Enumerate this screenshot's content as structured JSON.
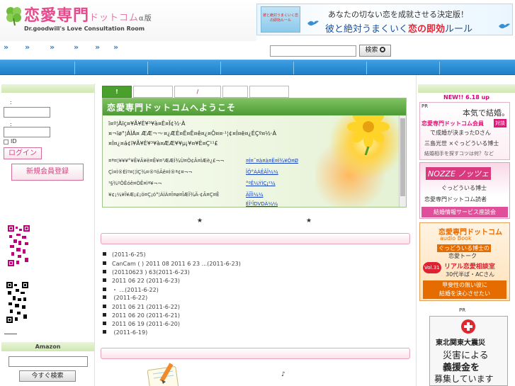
{
  "header": {
    "logo_title": "恋愛専門",
    "logo_suffix": "ドットコム",
    "logo_badge": "α版",
    "logo_subtitle": "Dr.goodwill's Love Consultation Room",
    "banner_book_text": "彼と絶対うまくいく恋の即効ルール",
    "banner_line1": "あなたの切ない恋を成就させる決定版！",
    "banner_line2_pre": "彼と絶対うまくいく",
    "banner_line2_red": "恋の即効",
    "banner_line2_post": "ルール"
  },
  "nav": {
    "arrows": [
      "»",
      "»",
      "»",
      "»",
      "»",
      "»"
    ],
    "search_value": "",
    "search_button": "検索"
  },
  "login": {
    "label1": ":",
    "label2": ":",
    "remember_label": "ID",
    "login_button": "ログイン",
    "register_button": "新規会員登録"
  },
  "amazon": {
    "heading": "Amazon",
    "search_button": "今すぐ検索"
  },
  "tabs": [
    {
      "label": "!"
    },
    {
      "label": ""
    },
    {
      "label": "/"
    },
    {
      "label": ""
    },
    {
      "label": ""
    }
  ],
  "welcome": {
    "title": "恋愛専門ドットコムへようこそ",
    "lines": [
      "ï¤º¦Àïç¤¥Ã¥È¥³¥à¤È¤Ï¢½·À",
      "¤¬ïø°¦ÀÌÀ¤ ÆÆ¬¬·¤¿ÆÈ¤Ë¤Ê¤ê¤¿¤Ô¤¤·¹¦¢¤Í¤ë¤¿ÉÇº¤½·À",
      "¤Ì¤¿¤á¢ï¥Ã¥È¥³¥à¤ÆÆ¥¥µ¡¥¤¥È¤Ç¹¹£"
    ],
    "news_left": [
      "¤ª¤¦¥¥¥°¥Ê¥Ä¥ë¤Ê¥¤³ÆÆÌ¾Ù¤Ò¢Â¤ÌÆè¿£¬¬",
      "Çì¤Ì®Èìº¤¦¦ÌÇ¾¤®ºöÃê¤Ì®ª¢¤¬¬",
      "¹§¾ºÔÊóê¤ÒÊ¤ìª¥¬¬",
      "¥¢¡¼¥Ï¥Æ¡£¡ö¤Ç¡ó°¦ÀÌÀ¤Ï¤ø¤ÎÆÏ¾Ä·¢Ã¤Ç¤Ê"
    ],
    "news_links": [
      "¤Ì¤¯¤à¤à¤Ë¤Ì¾¥Ò¤Ø",
      "ÎÔ°ÀÁÊÂÎ¼¼",
      "°ºÊ¼ÝÌÇ¡²¼",
      "ÄÎÎÌ¼¼"
    ],
    "news_link_extra": "ÉÎ¹ÎDVDÀ¼¼"
  },
  "stars": [
    "★",
    "★"
  ],
  "news": [
    {
      "text": "(2011-6-25)"
    },
    {
      "text": "CanCam (     ) 2011 08       2011 6 23  ...(2011-6-23)"
    },
    {
      "text": "(20110623 )              63(2011-6-23)"
    },
    {
      "text": "2011 06 22        (2011-6-23)"
    },
    {
      "text": "・                ...(2011-6-22)"
    },
    {
      "text": "          (2011-6-22)"
    },
    {
      "text": "2011 06 21          (2011-6-22)"
    },
    {
      "text": "2011 06 20          (2011-6-21)"
    },
    {
      "text": "2011 06 19          (2011-6-20)"
    },
    {
      "text": "                (2011-6-19)"
    }
  ],
  "music_note": "♪",
  "right": {
    "new_label": "NEW!! 6.18 up",
    "pr_label": "PR",
    "ad1": {
      "line1": "本気で結婚。",
      "line2": "恋愛専門ドットコム会員",
      "line3": "で成婚が決まったDさん",
      "line4": "三島光世 ×ぐっどういる博士",
      "line5": "結婚相手を探すコツは何？など",
      "badge": "対談"
    },
    "ad2": {
      "brand": "NOZZE ノッツェ",
      "line1": "ぐっどういる博士",
      "line2": "恋愛専門ドットコム読者",
      "line3": "結婚情報サービス座談会"
    },
    "ad3": {
      "line1": "恋愛専門ドットコム",
      "line2": "audio Book",
      "line3": "ぐっどういる博士の",
      "line4": "恋愛トーク",
      "badge": "Vol.31",
      "line5": "リアル恋愛相談室",
      "line6": "30代半ば・ACさん",
      "line7": "甲斐性の無い彼に",
      "line8": "結婚を決心させたい"
    },
    "pr_label2": "PR",
    "ad4": {
      "line1": "東北関東大震災",
      "line2": "災害による",
      "line3": "義援金を",
      "line4": "募集しています"
    }
  },
  "colors": {
    "accent_blue": "#1f7fc7",
    "brand_pink": "#e64a8c",
    "green": "#4aa02c"
  }
}
